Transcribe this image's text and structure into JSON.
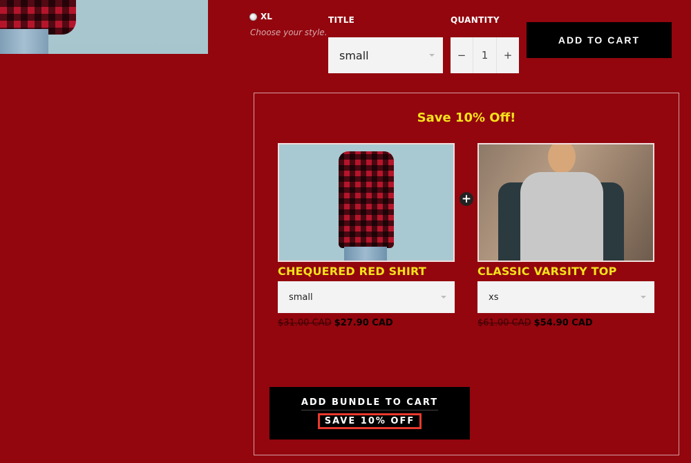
{
  "variant": {
    "option_label": "XL",
    "hint": "Choose your style."
  },
  "form": {
    "title_label": "TITLE",
    "title_value": "small",
    "quantity_label": "QUANTITY",
    "quantity_value": "1",
    "minus": "−",
    "plus": "+",
    "add_to_cart": "ADD TO CART"
  },
  "bundle": {
    "title": "Save 10% Off!",
    "plus_symbol": "+",
    "products": [
      {
        "name": "CHEQUERED RED SHIRT",
        "option": "small",
        "old_price": "$31.00 CAD",
        "new_price": "$27.90 CAD"
      },
      {
        "name": "CLASSIC VARSITY TOP",
        "option": "xs",
        "old_price": "$61.00 CAD",
        "new_price": "$54.90 CAD"
      }
    ],
    "button_line1": "ADD BUNDLE TO CART",
    "button_line2": "SAVE 10% OFF"
  },
  "colors": {
    "background": "#93060e",
    "accent_yellow": "#f5e21b",
    "button": "#000000",
    "highlight_box": "#e8392e"
  }
}
